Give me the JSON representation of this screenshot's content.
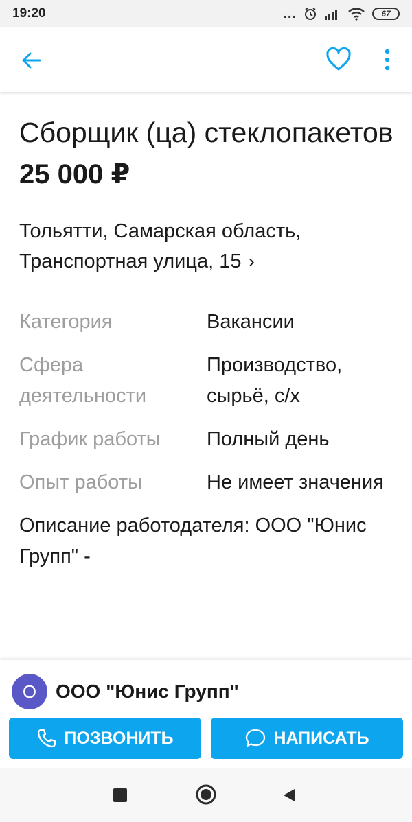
{
  "status_bar": {
    "time": "19:20",
    "dots": "...",
    "battery": "67"
  },
  "listing": {
    "title": "Сборщик (ца) стеклопакетов",
    "salary": "25 000 ₽",
    "address": "Тольятти, Самарская область, Транспортная улица, 15",
    "address_chevron": "›",
    "params": [
      {
        "key": "Категория",
        "value": "Вакансии"
      },
      {
        "key": "Сфера деятельности",
        "value": "Производство, сырьё, с/х"
      },
      {
        "key": "График работы",
        "value": "Полный день"
      },
      {
        "key": "Опыт работы",
        "value": "Не имеет значения"
      }
    ],
    "description": "Описание работодателя: ООО \"Юнис Групп\" -"
  },
  "seller": {
    "avatar_letter": "О",
    "name": "ООО \"Юнис Групп\""
  },
  "actions": {
    "call_label": "ПОЗВОНИТЬ",
    "write_label": "НАПИСАТЬ"
  },
  "colors": {
    "accent": "#0ea5ef",
    "avatar": "#5a58c6",
    "muted": "#9e9e9e"
  },
  "icons": [
    "back-arrow-icon",
    "heart-icon",
    "more-vertical-icon",
    "phone-icon",
    "chat-bubble-icon",
    "alarm-icon",
    "signal-icon",
    "wifi-icon",
    "battery-icon"
  ]
}
